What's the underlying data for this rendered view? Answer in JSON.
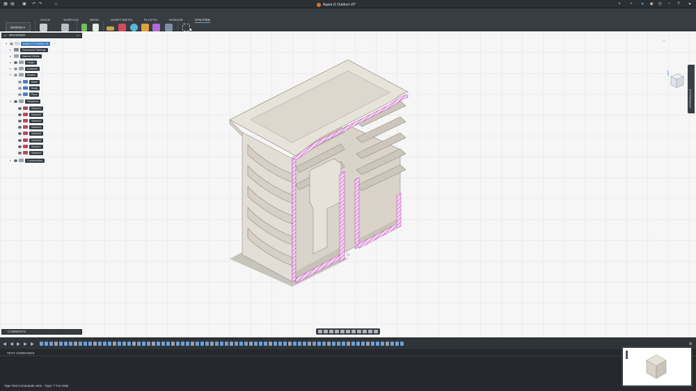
{
  "app": {
    "document_title": "Aqara t1 Outdoor v5*",
    "accent_color": "#5ea9e0",
    "brand_color": "#d0742b"
  },
  "tabs": [
    "SOLID",
    "SURFACE",
    "MESH",
    "SHEET METAL",
    "PLASTIC",
    "MANAGE",
    "UTILITIES"
  ],
  "active_tab": "UTILITIES",
  "workspace": "DESIGN",
  "tool_groups": [
    "MAKE",
    "ADD-INS",
    "UTILITY",
    "INSPECT",
    "SELECT"
  ],
  "browser": {
    "title": "BROWSER",
    "root": "Aqara t1 Outdoor v5",
    "items": [
      {
        "label": "Document Settings",
        "icon": "gear-icon",
        "level": 1
      },
      {
        "label": "Named Views",
        "icon": "folder-icon",
        "level": 1
      },
      {
        "label": "Origin",
        "icon": "folder-icon",
        "level": 1
      },
      {
        "label": "Analysis",
        "icon": "folder-icon",
        "level": 1
      },
      {
        "label": "Bodies",
        "icon": "folder-icon",
        "level": 1
      },
      {
        "label": "Base",
        "icon": "body-icon",
        "level": 2
      },
      {
        "label": "Body",
        "icon": "body-icon",
        "level": 2
      },
      {
        "label": "Roof",
        "icon": "body-icon",
        "level": 2
      },
      {
        "label": "Sketches",
        "icon": "folder-icon",
        "level": 1
      },
      {
        "label": "Sketch1",
        "icon": "sketch-icon",
        "level": 2
      },
      {
        "label": "Sketch2",
        "icon": "sketch-icon",
        "level": 2
      },
      {
        "label": "Sketch3",
        "icon": "sketch-icon",
        "level": 2
      },
      {
        "label": "Sketch4",
        "icon": "sketch-icon",
        "level": 2
      },
      {
        "label": "Sketch5",
        "icon": "sketch-icon",
        "level": 2
      },
      {
        "label": "Sketch6",
        "icon": "sketch-icon",
        "level": 2
      },
      {
        "label": "Sketch7",
        "icon": "sketch-icon",
        "level": 2
      },
      {
        "label": "Sketch9",
        "icon": "sketch-icon",
        "level": 2
      },
      {
        "label": "Construction",
        "icon": "folder-icon",
        "level": 1
      }
    ]
  },
  "side_panel": {
    "appearance": "APPEARANCE"
  },
  "comments": {
    "title": "COMMENTS"
  },
  "text_commands": {
    "title": "TEXT COMMANDS",
    "placeholder": "Type Text Commands Here - Type '?' For Help"
  }
}
